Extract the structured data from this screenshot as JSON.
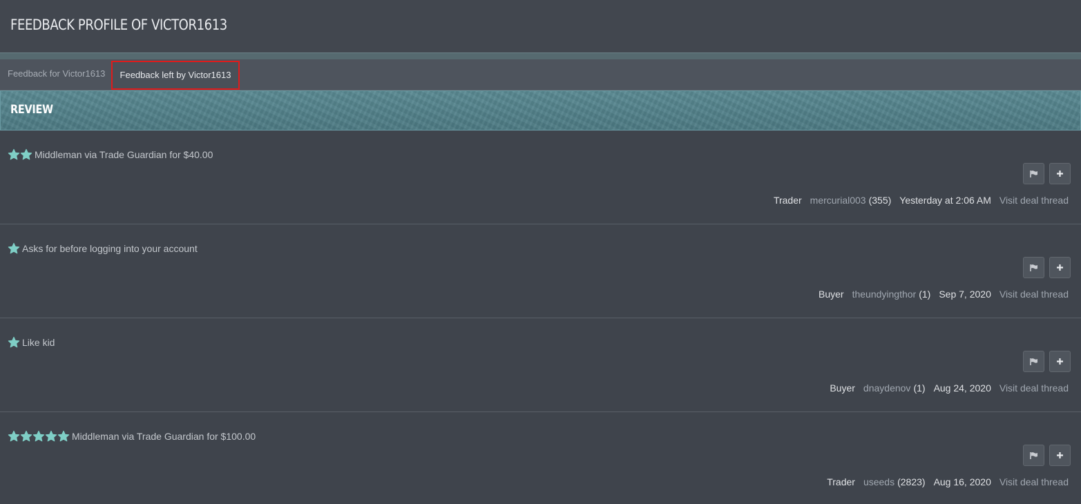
{
  "page": {
    "title": "FEEDBACK PROFILE OF VICTOR1613"
  },
  "tabs": [
    {
      "label": "Feedback for Victor1613",
      "active": false
    },
    {
      "label": "Feedback left by Victor1613",
      "active": true
    }
  ],
  "section": {
    "title": "REVIEW"
  },
  "colors": {
    "star": "#7fcfc6",
    "highlight": "#e01b1b"
  },
  "feedback": [
    {
      "stars": 2,
      "text": "Middleman via Trade Guardian for $40.00",
      "role": "Trader",
      "user": "mercurial003",
      "count": "(355)",
      "date": "Yesterday at 2:06 AM",
      "visit": "Visit deal thread"
    },
    {
      "stars": 1,
      "text": "Asks for before logging into your account",
      "role": "Buyer",
      "user": "theundyingthor",
      "count": "(1)",
      "date": "Sep 7, 2020",
      "visit": "Visit deal thread"
    },
    {
      "stars": 1,
      "text": "Like kid",
      "role": "Buyer",
      "user": "dnaydenov",
      "count": "(1)",
      "date": "Aug 24, 2020",
      "visit": "Visit deal thread"
    },
    {
      "stars": 5,
      "text": "Middleman via Trade Guardian for $100.00",
      "role": "Trader",
      "user": "useeds",
      "count": "(2823)",
      "date": "Aug 16, 2020",
      "visit": "Visit deal thread"
    }
  ],
  "icons": {
    "report": "flag-icon",
    "add": "plus-icon",
    "star": "star-icon"
  }
}
